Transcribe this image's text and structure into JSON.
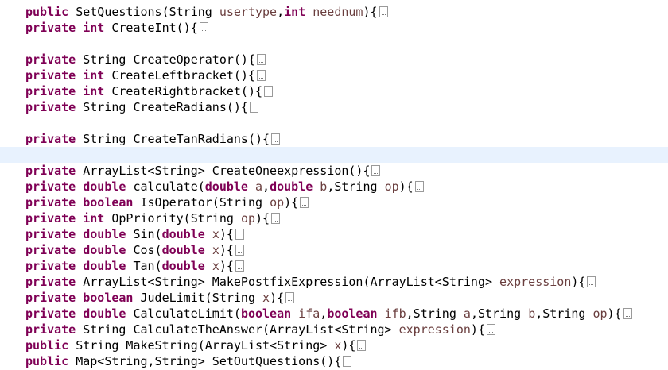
{
  "editor": {
    "lines": [
      [
        {
          "t": "public",
          "k": 1
        },
        {
          "t": " SetQuestions(String "
        },
        {
          "t": "usertype",
          "p": 1
        },
        {
          "t": ","
        },
        {
          "t": "int",
          "k": 1
        },
        {
          "t": " "
        },
        {
          "t": "neednum",
          "p": 1
        },
        {
          "t": "){"
        }
      ],
      [
        {
          "t": "private",
          "k": 1
        },
        {
          "t": " "
        },
        {
          "t": "int",
          "k": 1
        },
        {
          "t": " CreateInt(){"
        }
      ],
      [],
      [
        {
          "t": "private",
          "k": 1
        },
        {
          "t": " String CreateOperator(){"
        }
      ],
      [
        {
          "t": "private",
          "k": 1
        },
        {
          "t": " "
        },
        {
          "t": "int",
          "k": 1
        },
        {
          "t": " CreateLeftbracket(){"
        }
      ],
      [
        {
          "t": "private",
          "k": 1
        },
        {
          "t": " "
        },
        {
          "t": "int",
          "k": 1
        },
        {
          "t": " CreateRightbracket(){"
        }
      ],
      [
        {
          "t": "private",
          "k": 1
        },
        {
          "t": " String CreateRadians(){"
        }
      ],
      [],
      [
        {
          "t": "private",
          "k": 1
        },
        {
          "t": " String CreateTanRadians(){"
        }
      ],
      [],
      [
        {
          "t": "private",
          "k": 1
        },
        {
          "t": " ArrayList<String> CreateOneexpression(){"
        }
      ],
      [
        {
          "t": "private",
          "k": 1
        },
        {
          "t": " "
        },
        {
          "t": "double",
          "k": 1
        },
        {
          "t": " calculate("
        },
        {
          "t": "double",
          "k": 1
        },
        {
          "t": " "
        },
        {
          "t": "a",
          "p": 1
        },
        {
          "t": ","
        },
        {
          "t": "double",
          "k": 1
        },
        {
          "t": " "
        },
        {
          "t": "b",
          "p": 1
        },
        {
          "t": ",String "
        },
        {
          "t": "op",
          "p": 1
        },
        {
          "t": "){"
        }
      ],
      [
        {
          "t": "private",
          "k": 1
        },
        {
          "t": " "
        },
        {
          "t": "boolean",
          "k": 1
        },
        {
          "t": " IsOperator(String "
        },
        {
          "t": "op",
          "p": 1
        },
        {
          "t": "){"
        }
      ],
      [
        {
          "t": "private",
          "k": 1
        },
        {
          "t": " "
        },
        {
          "t": "int",
          "k": 1
        },
        {
          "t": " OpPriority(String "
        },
        {
          "t": "op",
          "p": 1
        },
        {
          "t": "){"
        }
      ],
      [
        {
          "t": "private",
          "k": 1
        },
        {
          "t": " "
        },
        {
          "t": "double",
          "k": 1
        },
        {
          "t": " Sin("
        },
        {
          "t": "double",
          "k": 1
        },
        {
          "t": " "
        },
        {
          "t": "x",
          "p": 1
        },
        {
          "t": "){"
        }
      ],
      [
        {
          "t": "private",
          "k": 1
        },
        {
          "t": " "
        },
        {
          "t": "double",
          "k": 1
        },
        {
          "t": " Cos("
        },
        {
          "t": "double",
          "k": 1
        },
        {
          "t": " "
        },
        {
          "t": "x",
          "p": 1
        },
        {
          "t": "){"
        }
      ],
      [
        {
          "t": "private",
          "k": 1
        },
        {
          "t": " "
        },
        {
          "t": "double",
          "k": 1
        },
        {
          "t": " Tan("
        },
        {
          "t": "double",
          "k": 1
        },
        {
          "t": " "
        },
        {
          "t": "x",
          "p": 1
        },
        {
          "t": "){"
        }
      ],
      [
        {
          "t": "private",
          "k": 1
        },
        {
          "t": " ArrayList<String> MakePostfixExpression(ArrayList<String> "
        },
        {
          "t": "expression",
          "p": 1
        },
        {
          "t": "){"
        }
      ],
      [
        {
          "t": "private",
          "k": 1
        },
        {
          "t": " "
        },
        {
          "t": "boolean",
          "k": 1
        },
        {
          "t": " JudeLimit(String "
        },
        {
          "t": "x",
          "p": 1
        },
        {
          "t": "){"
        }
      ],
      [
        {
          "t": "private",
          "k": 1
        },
        {
          "t": " "
        },
        {
          "t": "double",
          "k": 1
        },
        {
          "t": " CalculateLimit("
        },
        {
          "t": "boolean",
          "k": 1
        },
        {
          "t": " "
        },
        {
          "t": "ifa",
          "p": 1
        },
        {
          "t": ","
        },
        {
          "t": "boolean",
          "k": 1
        },
        {
          "t": " "
        },
        {
          "t": "ifb",
          "p": 1
        },
        {
          "t": ",String "
        },
        {
          "t": "a",
          "p": 1
        },
        {
          "t": ",String "
        },
        {
          "t": "b",
          "p": 1
        },
        {
          "t": ",String "
        },
        {
          "t": "op",
          "p": 1
        },
        {
          "t": "){"
        }
      ],
      [
        {
          "t": "private",
          "k": 1
        },
        {
          "t": " String CalculateTheAnswer(ArrayList<String> "
        },
        {
          "t": "expression",
          "p": 1
        },
        {
          "t": "){"
        }
      ],
      [
        {
          "t": "public",
          "k": 1
        },
        {
          "t": " String MakeString(ArrayList<String> "
        },
        {
          "t": "x",
          "p": 1
        },
        {
          "t": "){"
        }
      ],
      [
        {
          "t": "public",
          "k": 1
        },
        {
          "t": " Map<String,String> SetOutQuestions(){"
        }
      ]
    ],
    "colors": {
      "keyword": "#7f0055",
      "parameter": "#6a3e3e",
      "text": "#000000",
      "current_line": "#e8f2fe"
    },
    "fold_icon": "collapsed-fold-icon"
  }
}
